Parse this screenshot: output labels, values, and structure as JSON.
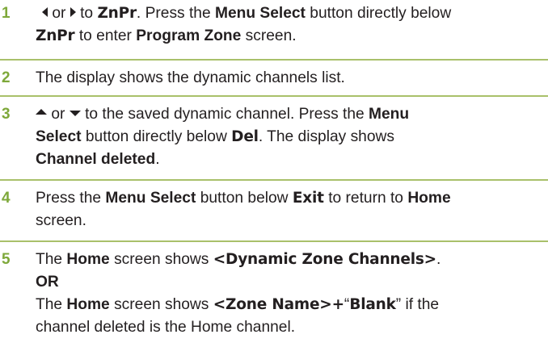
{
  "colors": {
    "accent": "#7ea83a",
    "separator": "#a9c06a",
    "text": "#231f20"
  },
  "steps": [
    {
      "number": "1",
      "or": "or",
      "t1": "to",
      "znpr": "ZnPr",
      "t2": ". Press the",
      "menu_select": "Menu Select",
      "t3": "button directly below",
      "znpr2": "ZnPr",
      "t4": "to enter",
      "program_zone": "Program Zone",
      "t5": "screen."
    },
    {
      "number": "2",
      "text": "The display shows the dynamic channels list."
    },
    {
      "number": "3",
      "or": "or",
      "t1": "to the saved dynamic channel. Press the",
      "menu": "Menu",
      "select": "Select",
      "t2": "button directly below",
      "del": "Del",
      "t3": ". The display shows",
      "channel_deleted": "Channel deleted",
      "t4": "."
    },
    {
      "number": "4",
      "t1": "Press the",
      "menu_select": "Menu Select",
      "t2": "button below",
      "exit": "Exit",
      "t3": "to return to",
      "home": "Home",
      "t4": "screen."
    },
    {
      "number": "5",
      "t1": "The",
      "home": "Home",
      "t2": "screen shows",
      "dyn": "<Dynamic Zone Channels>",
      "t3": ".",
      "or_label": "OR",
      "t4": "The",
      "home2": "Home",
      "t5": "screen shows",
      "zone_name": "<Zone Name>+",
      "q_open": "“",
      "blank": "Blank",
      "q_close": "”",
      "t6": "if the",
      "t7": "channel deleted is the Home channel."
    }
  ],
  "icons": {
    "left": "left-triangle-icon",
    "right": "right-triangle-icon",
    "up": "up-triangle-icon",
    "down": "down-triangle-icon"
  }
}
